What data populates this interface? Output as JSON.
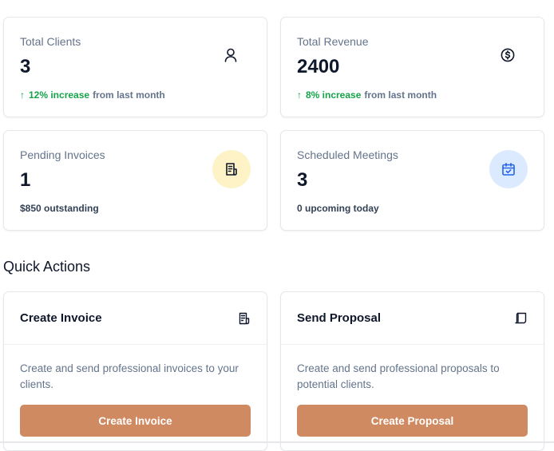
{
  "stats": [
    {
      "label": "Total Clients",
      "value": "3",
      "trend": "12% increase",
      "trend_rest": "from last month",
      "icon": "user-icon"
    },
    {
      "label": "Total Revenue",
      "value": "2400",
      "trend": "8% increase",
      "trend_rest": "from last month",
      "icon": "dollar-circle-icon"
    },
    {
      "label": "Pending Invoices",
      "value": "1",
      "note": "$850 outstanding",
      "icon": "invoice-icon",
      "icon_bg": "#fef3c7"
    },
    {
      "label": "Scheduled Meetings",
      "value": "3",
      "note": "0 upcoming today",
      "icon": "calendar-check-icon",
      "icon_bg": "#dbeafe"
    }
  ],
  "trend_arrow": "↑",
  "quick_actions": {
    "title": "Quick Actions",
    "items": [
      {
        "title": "Create Invoice",
        "icon": "receipt-icon",
        "description": "Create and send professional invoices to your clients.",
        "button_label": "Create Invoice"
      },
      {
        "title": "Send Proposal",
        "icon": "scroll-icon",
        "description": "Create and send professional proposals to potential clients.",
        "button_label": "Create Proposal"
      }
    ]
  },
  "colors": {
    "accent": "#d08a62",
    "trend_green": "#16a34a",
    "muted_text": "#64748b",
    "yellow_icon_bg": "#fef3c7",
    "blue_icon_bg": "#dbeafe",
    "blue_icon": "#2563eb"
  }
}
